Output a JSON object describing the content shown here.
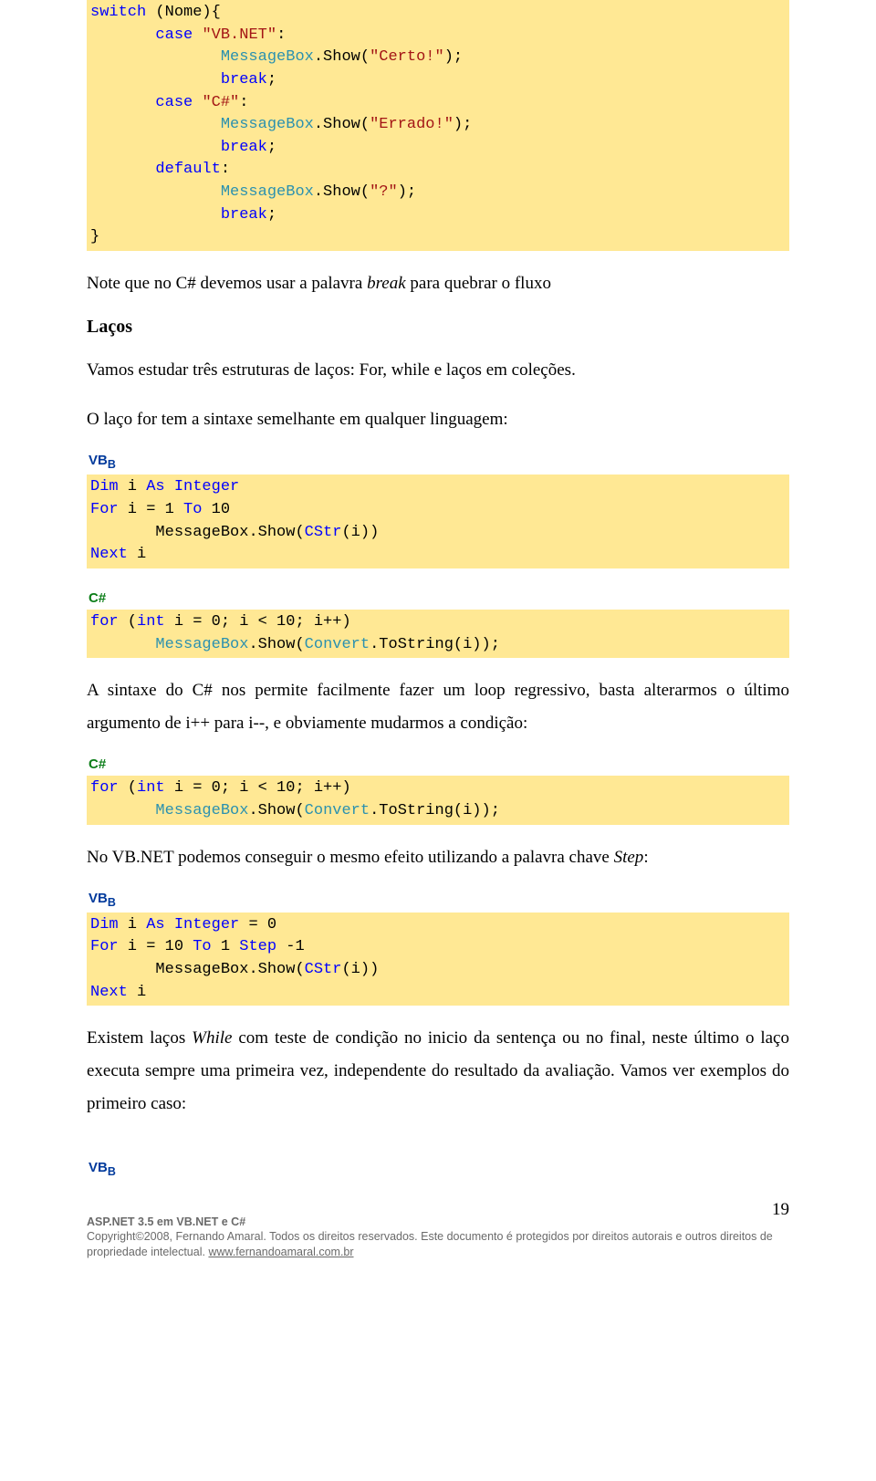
{
  "code1": {
    "l1a": "switch",
    "l1b": " (Nome){",
    "l2a": "       ",
    "l2b": "case",
    "l2c": " ",
    "l2d": "\"VB.NET\"",
    "l2e": ":",
    "l3a": "              ",
    "l3b": "MessageBox",
    "l3c": ".Show(",
    "l3d": "\"Certo!\"",
    "l3e": ");",
    "l4a": "              ",
    "l4b": "break",
    "l4c": ";",
    "l5a": "       ",
    "l5b": "case",
    "l5c": " ",
    "l5d": "\"C#\"",
    "l5e": ":",
    "l6a": "              ",
    "l6b": "MessageBox",
    "l6c": ".Show(",
    "l6d": "\"Errado!\"",
    "l6e": ");",
    "l7a": "              ",
    "l7b": "break",
    "l7c": ";",
    "l8a": "       ",
    "l8b": "default",
    "l8c": ":",
    "l9a": "              ",
    "l9b": "MessageBox",
    "l9c": ".Show(",
    "l9d": "\"?\"",
    "l9e": ");",
    "l10a": "              ",
    "l10b": "break",
    "l10c": ";",
    "l11": "}"
  },
  "para1a": "Note que no C# devemos usar a palavra ",
  "para1b": "break",
  "para1c": " para quebrar o fluxo",
  "heading1": "Laços",
  "para2": "Vamos estudar três estruturas de laços: For, while e laços em coleções.",
  "para3": "O laço for tem a sintaxe semelhante em qualquer linguagem:",
  "vb_label": "VB",
  "csharp_label": "C",
  "csharp_hash": "#",
  "code2": {
    "l1a": "Dim",
    "l1b": " i ",
    "l1c": "As",
    "l1d": " ",
    "l1e": "Integer",
    "l2a": "For",
    "l2b": " i = 1 ",
    "l2c": "To",
    "l2d": " 10",
    "l3a": "       ",
    "l3b": "MessageBox.Show(",
    "l3c": "CStr",
    "l3d": "(i))",
    "l4a": "Next",
    "l4b": " i"
  },
  "code3": {
    "l1a": "for",
    "l1b": " (",
    "l1c": "int",
    "l1d": " i = 0; i < 10; i++)",
    "l2a": "       ",
    "l2b": "MessageBox",
    "l2c": ".Show(",
    "l2d": "Convert",
    "l2e": ".ToString(i));"
  },
  "para4": "A sintaxe do C# nos permite facilmente fazer um loop regressivo, basta alterarmos o último argumento de i++ para i--, e obviamente mudarmos a condição:",
  "code4": {
    "l1a": "for",
    "l1b": " (",
    "l1c": "int",
    "l1d": " i = 0; i < 10; i++)",
    "l2a": "       ",
    "l2b": "MessageBox",
    "l2c": ".Show(",
    "l2d": "Convert",
    "l2e": ".ToString(i));"
  },
  "para5a": "No VB.NET podemos conseguir o mesmo efeito utilizando a palavra chave ",
  "para5b": "Step",
  "para5c": ":",
  "code5": {
    "l1a": "Dim",
    "l1b": " i ",
    "l1c": "As",
    "l1d": " ",
    "l1e": "Integer",
    "l1f": " = 0",
    "l2a": "For",
    "l2b": " i = 10 ",
    "l2c": "To",
    "l2d": " 1 ",
    "l2e": "Step",
    "l2f": " -1",
    "l3a": "       ",
    "l3b": "MessageBox.Show(",
    "l3c": "CStr",
    "l3d": "(i))",
    "l4a": "Next",
    "l4b": " i"
  },
  "para6a": "Existem laços ",
  "para6b": "While",
  "para6c": " com teste de condição no inicio da sentença ou no final, neste último o laço executa sempre uma primeira vez, independente do resultado da avaliação. Vamos ver exemplos do primeiro caso:",
  "page_num": "19",
  "footer": {
    "line1": "ASP.NET 3.5 em VB.NET e C#",
    "line2": "Copyright©2008,  Fernando Amaral. Todos os direitos reservados. Este documento é protegidos por direitos autorais e outros direitos de propriedade intelectual. ",
    "link": "www.fernandoamaral.com.br"
  }
}
